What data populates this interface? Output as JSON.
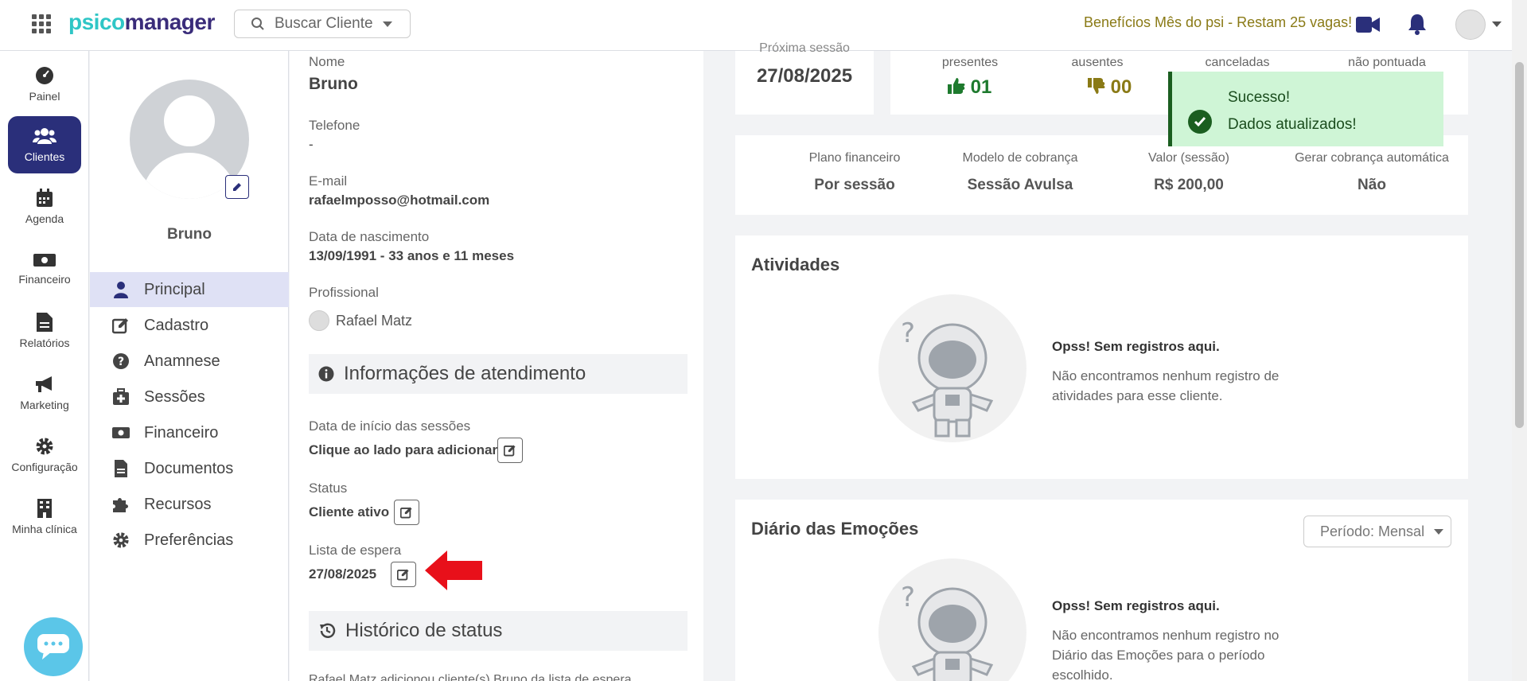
{
  "topbar": {
    "logo_part1": "psico",
    "logo_part2": "manager",
    "search_placeholder": "Buscar Cliente",
    "promo": "Benefícios Mês do psi - Restam 25 vagas!",
    "icons": [
      "apps-grid-icon",
      "video-icon",
      "bell-icon",
      "user-avatar"
    ]
  },
  "leftnav": {
    "items": [
      {
        "label": "Painel",
        "icon": "dashboard-icon"
      },
      {
        "label": "Clientes",
        "icon": "users-icon",
        "active": true
      },
      {
        "label": "Agenda",
        "icon": "calendar-icon"
      },
      {
        "label": "Financeiro",
        "icon": "money-icon"
      },
      {
        "label": "Relatórios",
        "icon": "file-icon"
      },
      {
        "label": "Marketing",
        "icon": "megaphone-icon"
      },
      {
        "label": "Configuração",
        "icon": "gear-icon"
      },
      {
        "label": "Minha clínica",
        "icon": "building-icon"
      }
    ]
  },
  "profile": {
    "name": "Bruno",
    "menu": [
      {
        "label": "Principal",
        "icon": "user-icon",
        "active": true
      },
      {
        "label": "Cadastro",
        "icon": "edit-icon"
      },
      {
        "label": "Anamnese",
        "icon": "question-icon"
      },
      {
        "label": "Sessões",
        "icon": "medkit-icon"
      },
      {
        "label": "Financeiro",
        "icon": "money-icon"
      },
      {
        "label": "Documentos",
        "icon": "file-icon"
      },
      {
        "label": "Recursos",
        "icon": "puzzle-icon"
      },
      {
        "label": "Preferências",
        "icon": "gear-icon"
      }
    ]
  },
  "details": {
    "nome_label": "Nome",
    "nome": "Bruno",
    "telefone_label": "Telefone",
    "telefone": "-",
    "email_label": "E-mail",
    "email": "rafaelmposso@hotmail.com",
    "nascimento_label": "Data de nascimento",
    "nascimento": "13/09/1991 - 33 anos e 11 meses",
    "profissional_label": "Profissional",
    "profissional": "Rafael Matz",
    "atendimento_title": "Informações de atendimento",
    "inicio_label": "Data de início das sessões",
    "inicio": "Clique ao lado para adicionar",
    "status_label": "Status",
    "status": "Cliente ativo",
    "espera_label": "Lista de espera",
    "espera": "27/08/2025",
    "historico_title": "Histórico de status",
    "historico_text": "Rafael Matz adicionou cliente(s) Bruno da lista de espera"
  },
  "stats": {
    "proxima_label": "Próxima sessão",
    "proxima": "27/08/2025",
    "presentes_label": "presentes",
    "presentes": "01",
    "ausentes_label": "ausentes",
    "ausentes": "00",
    "canceladas_label": "canceladas",
    "naopontuada_label": "não pontuada"
  },
  "finance": {
    "plano_label": "Plano financeiro",
    "plano": "Por sessão",
    "modelo_label": "Modelo de cobrança",
    "modelo": "Sessão Avulsa",
    "valor_label": "Valor (sessão)",
    "valor": "R$ 200,00",
    "auto_label": "Gerar cobrança automática",
    "auto": "Não"
  },
  "toast": {
    "title": "Sucesso!",
    "message": "Dados atualizados!"
  },
  "atividades": {
    "title": "Atividades",
    "empty_title": "Opss! Sem registros aqui.",
    "empty_text": "Não encontramos nenhum registro de atividades para esse cliente."
  },
  "diario": {
    "title": "Diário das Emoções",
    "period": "Período: Mensal",
    "empty_title": "Opss! Sem registros aqui.",
    "empty_text": "Não encontramos nenhum registro no Diário das Emoções para o período escolhido."
  },
  "colors": {
    "primary": "#2a2f7a",
    "accent": "#2fc6c6",
    "success_bg": "#cff5d6",
    "success": "#1b5e20",
    "promo": "#8a7a16",
    "present": "#1e7a2e",
    "absent": "#8a7a16"
  }
}
